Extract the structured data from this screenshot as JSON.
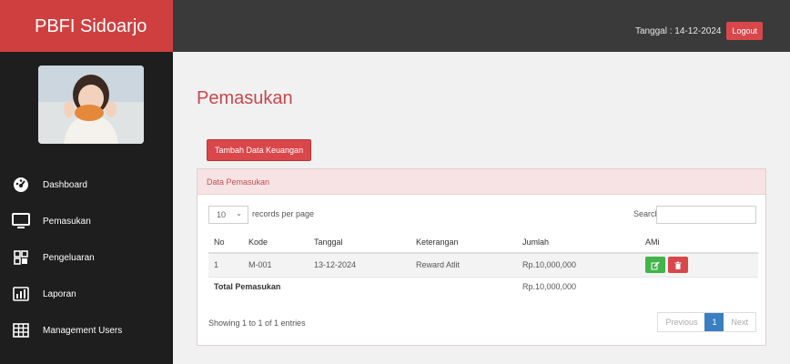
{
  "app": {
    "brand": "PBFI Sidoarjo"
  },
  "header": {
    "date": "Tanggal : 14-12-2024",
    "logout_label": "Logout"
  },
  "sidebar": {
    "items": [
      {
        "label": "Dashboard",
        "icon": "dashboard-icon"
      },
      {
        "label": "Pemasukan",
        "icon": "monitor-icon"
      },
      {
        "label": "Pengeluaran",
        "icon": "barcode-icon"
      },
      {
        "label": "Laporan",
        "icon": "bar-chart-icon"
      },
      {
        "label": "Management Users",
        "icon": "table-icon"
      }
    ]
  },
  "main": {
    "title": "Pemasukan",
    "add_button": "Tambah Data Keuangan",
    "panel_title": "Data Pemasukan",
    "page_length": "10",
    "records_label": "records per page",
    "search_label": "Search:",
    "columns": [
      "No",
      "Kode",
      "Tanggal",
      "Keterangan",
      "Jumlah",
      "AMi"
    ],
    "rows": [
      {
        "no": "1",
        "kode": "M-001",
        "tanggal": "13-12-2024",
        "keterangan": "Reward Atlit",
        "jumlah": "Rp.10,000,000"
      }
    ],
    "total_label": "Total Pemasukan",
    "total_value": "Rp.10,000,000",
    "info": "Showing 1 to 1 of 1 entries",
    "pagination": {
      "previous": "Previous",
      "current": "1",
      "next": "Next"
    }
  },
  "colors": {
    "accent": "#d9474a",
    "sidebar_bg": "#1e1e1e",
    "topbar_bg": "#3a3a3a",
    "pager_active": "#3a7fc1",
    "edit": "#41b44a"
  }
}
